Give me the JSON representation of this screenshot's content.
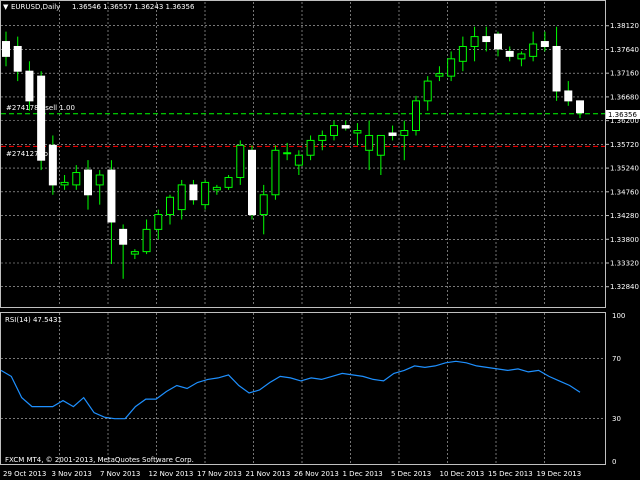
{
  "header": {
    "symbol": "EURUSD,Daily",
    "ohlc": "1.36546 1.36557 1.36243 1.36356"
  },
  "orders": {
    "sell_label": "#2741788 sell 1.00",
    "tp_label": "#274127 tp"
  },
  "rsi_header": "RSI(14) 47.5431",
  "copyright": "FXCM MT4, © 2001-2013, MetaQuotes Software Corp.",
  "colors": {
    "background": "#000000",
    "grid": "#c0c0c0",
    "candle_up_fill": "#000000",
    "candle_down_fill": "#ffffff",
    "candle_outline": "#ffffff",
    "wick": "#00ff00",
    "sell_line": "#00ff00",
    "tp_line": "#ff0000",
    "rsi_line": "#1e90ff",
    "current_price_label_bg": "#ffffff"
  },
  "chart_data": [
    {
      "type": "candlestick",
      "title": "EURUSD,Daily",
      "ylim": [
        1.3245,
        1.386
      ],
      "y_ticks": [
        "1.38120",
        "1.37640",
        "1.37160",
        "1.36680",
        "1.36200",
        "1.35720",
        "1.35240",
        "1.34760",
        "1.34280",
        "1.33800",
        "1.33320",
        "1.32840"
      ],
      "current_price": "1.36356",
      "x_labels": [
        "29 Oct 2013",
        "3 Nov 2013",
        "7 Nov 2013",
        "12 Nov 2013",
        "17 Nov 2013",
        "21 Nov 2013",
        "26 Nov 2013",
        "1 Dec 2013",
        "5 Dec 2013",
        "10 Dec 2013",
        "15 Dec 2013",
        "19 Dec 2013"
      ],
      "sell_level": 1.3634,
      "tp_level": 1.3568,
      "candles": [
        {
          "o": 1.378,
          "h": 1.38,
          "l": 1.373,
          "c": 1.375
        },
        {
          "o": 1.377,
          "h": 1.379,
          "l": 1.37,
          "c": 1.372
        },
        {
          "o": 1.372,
          "h": 1.374,
          "l": 1.364,
          "c": 1.366
        },
        {
          "o": 1.371,
          "h": 1.372,
          "l": 1.352,
          "c": 1.354
        },
        {
          "o": 1.357,
          "h": 1.359,
          "l": 1.347,
          "c": 1.349
        },
        {
          "o": 1.349,
          "h": 1.351,
          "l": 1.348,
          "c": 1.3495
        },
        {
          "o": 1.349,
          "h": 1.353,
          "l": 1.348,
          "c": 1.3515
        },
        {
          "o": 1.352,
          "h": 1.354,
          "l": 1.344,
          "c": 1.347
        },
        {
          "o": 1.349,
          "h": 1.352,
          "l": 1.345,
          "c": 1.351
        },
        {
          "o": 1.352,
          "h": 1.354,
          "l": 1.333,
          "c": 1.3415
        },
        {
          "o": 1.34,
          "h": 1.341,
          "l": 1.33,
          "c": 1.337
        },
        {
          "o": 1.335,
          "h": 1.336,
          "l": 1.334,
          "c": 1.3355
        },
        {
          "o": 1.3355,
          "h": 1.342,
          "l": 1.335,
          "c": 1.34
        },
        {
          "o": 1.34,
          "h": 1.344,
          "l": 1.338,
          "c": 1.343
        },
        {
          "o": 1.343,
          "h": 1.347,
          "l": 1.341,
          "c": 1.3465
        },
        {
          "o": 1.344,
          "h": 1.35,
          "l": 1.342,
          "c": 1.349
        },
        {
          "o": 1.349,
          "h": 1.35,
          "l": 1.345,
          "c": 1.346
        },
        {
          "o": 1.345,
          "h": 1.35,
          "l": 1.344,
          "c": 1.3495
        },
        {
          "o": 1.348,
          "h": 1.349,
          "l": 1.347,
          "c": 1.3485
        },
        {
          "o": 1.3485,
          "h": 1.351,
          "l": 1.348,
          "c": 1.3505
        },
        {
          "o": 1.3505,
          "h": 1.358,
          "l": 1.349,
          "c": 1.357
        },
        {
          "o": 1.356,
          "h": 1.357,
          "l": 1.342,
          "c": 1.343
        },
        {
          "o": 1.343,
          "h": 1.349,
          "l": 1.339,
          "c": 1.347
        },
        {
          "o": 1.347,
          "h": 1.357,
          "l": 1.346,
          "c": 1.356
        },
        {
          "o": 1.3555,
          "h": 1.3575,
          "l": 1.354,
          "c": 1.3555
        },
        {
          "o": 1.353,
          "h": 1.356,
          "l": 1.351,
          "c": 1.355
        },
        {
          "o": 1.355,
          "h": 1.359,
          "l": 1.354,
          "c": 1.358
        },
        {
          "o": 1.358,
          "h": 1.36,
          "l": 1.356,
          "c": 1.359
        },
        {
          "o": 1.359,
          "h": 1.362,
          "l": 1.358,
          "c": 1.361
        },
        {
          "o": 1.361,
          "h": 1.362,
          "l": 1.36,
          "c": 1.3605
        },
        {
          "o": 1.3595,
          "h": 1.3615,
          "l": 1.357,
          "c": 1.36
        },
        {
          "o": 1.356,
          "h": 1.362,
          "l": 1.352,
          "c": 1.359
        },
        {
          "o": 1.355,
          "h": 1.358,
          "l": 1.351,
          "c": 1.359
        },
        {
          "o": 1.3595,
          "h": 1.361,
          "l": 1.358,
          "c": 1.359
        },
        {
          "o": 1.359,
          "h": 1.362,
          "l": 1.354,
          "c": 1.36
        },
        {
          "o": 1.36,
          "h": 1.367,
          "l": 1.359,
          "c": 1.366
        },
        {
          "o": 1.366,
          "h": 1.371,
          "l": 1.364,
          "c": 1.37
        },
        {
          "o": 1.371,
          "h": 1.373,
          "l": 1.37,
          "c": 1.3715
        },
        {
          "o": 1.371,
          "h": 1.376,
          "l": 1.37,
          "c": 1.3745
        },
        {
          "o": 1.374,
          "h": 1.379,
          "l": 1.372,
          "c": 1.377
        },
        {
          "o": 1.377,
          "h": 1.381,
          "l": 1.374,
          "c": 1.379
        },
        {
          "o": 1.379,
          "h": 1.381,
          "l": 1.376,
          "c": 1.378
        },
        {
          "o": 1.3795,
          "h": 1.38,
          "l": 1.375,
          "c": 1.3765
        },
        {
          "o": 1.376,
          "h": 1.377,
          "l": 1.374,
          "c": 1.375
        },
        {
          "o": 1.3745,
          "h": 1.376,
          "l": 1.373,
          "c": 1.3755
        },
        {
          "o": 1.375,
          "h": 1.38,
          "l": 1.374,
          "c": 1.3775
        },
        {
          "o": 1.378,
          "h": 1.38,
          "l": 1.376,
          "c": 1.377
        },
        {
          "o": 1.377,
          "h": 1.381,
          "l": 1.366,
          "c": 1.368
        },
        {
          "o": 1.368,
          "h": 1.37,
          "l": 1.365,
          "c": 1.366
        },
        {
          "o": 1.366,
          "h": 1.366,
          "l": 1.3625,
          "c": 1.3636
        }
      ]
    },
    {
      "type": "line",
      "title": "RSI(14) 47.5431",
      "ylim": [
        0,
        100
      ],
      "y_ticks": [
        "100",
        "70",
        "30",
        "0"
      ],
      "levels": [
        70,
        30
      ],
      "series": [
        {
          "values": [
            62,
            58,
            44,
            38,
            38,
            38,
            42,
            38,
            44,
            34,
            31,
            30,
            30,
            38,
            43,
            43,
            48,
            52,
            50,
            54,
            56,
            57,
            59,
            52,
            47,
            49,
            54,
            58,
            57,
            55,
            57,
            56,
            58,
            60,
            59,
            58,
            56,
            55,
            60,
            62,
            65,
            64,
            65,
            67,
            68,
            67,
            65,
            64,
            63,
            62,
            63,
            61,
            62,
            58,
            55,
            52,
            47.5
          ]
        }
      ]
    }
  ]
}
